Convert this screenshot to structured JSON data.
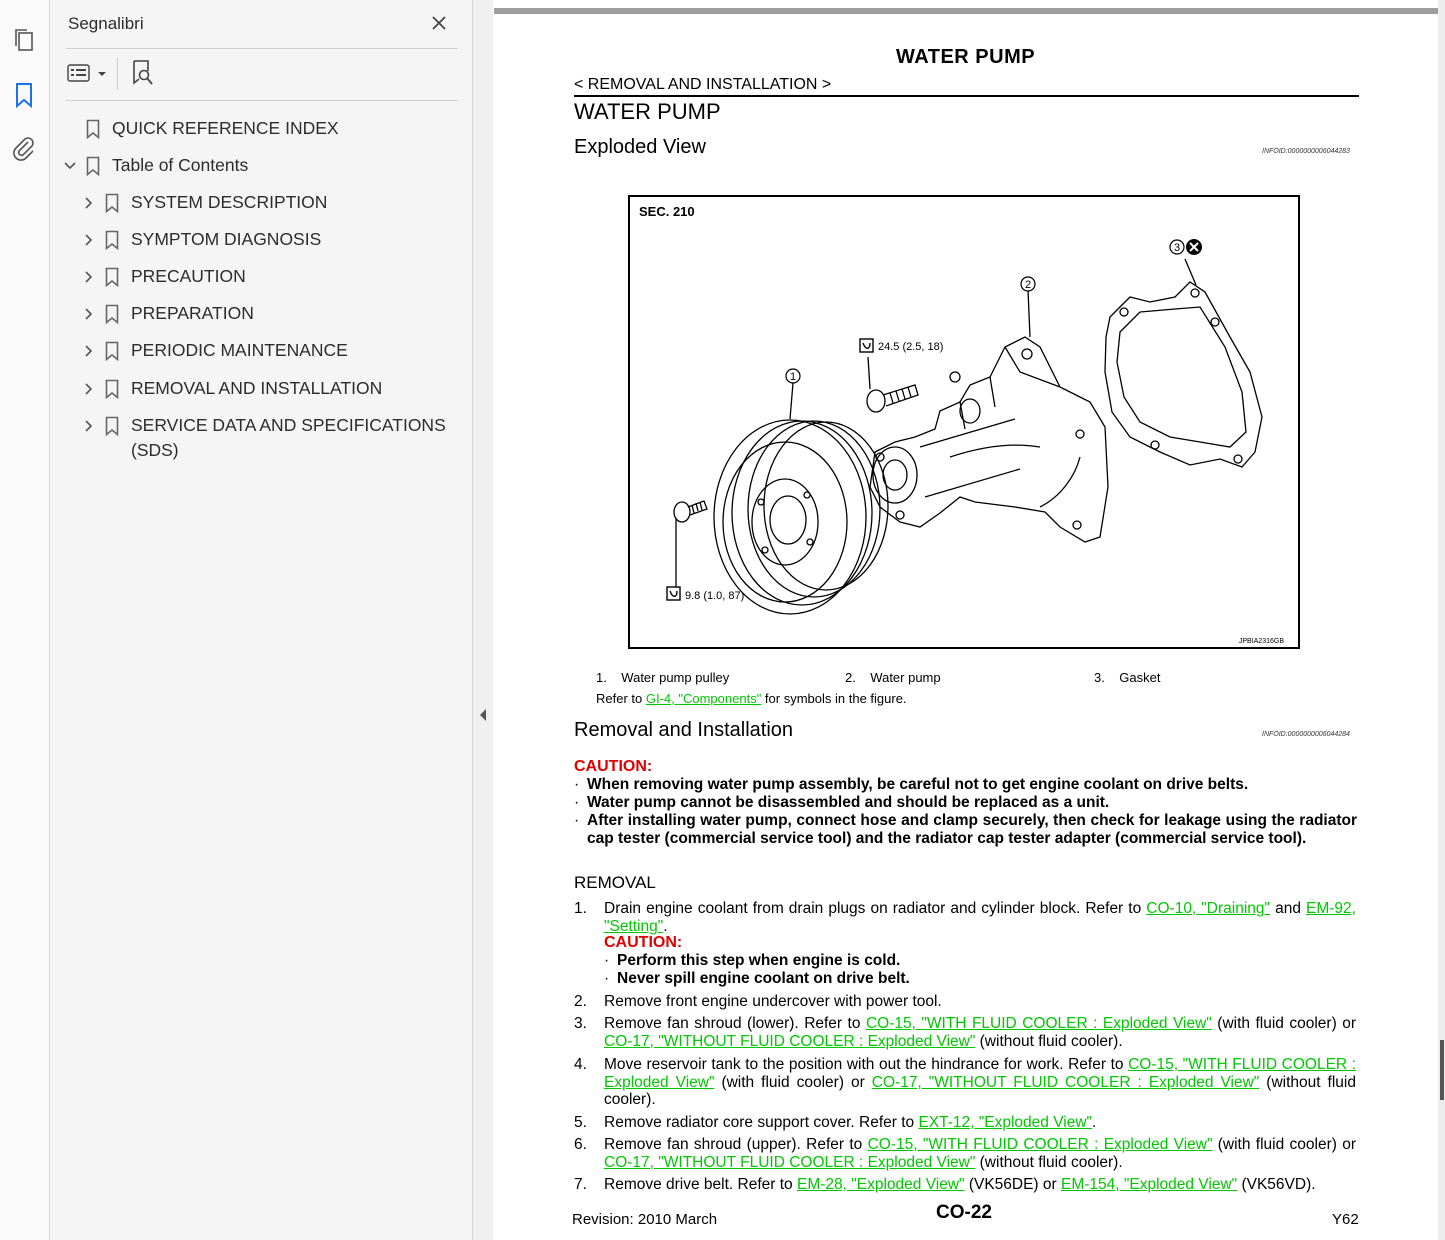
{
  "sidebar": {
    "title": "Segnalibri",
    "items": [
      {
        "label": "QUICK REFERENCE INDEX"
      },
      {
        "label": "Table of Contents"
      },
      {
        "label": "SYSTEM DESCRIPTION"
      },
      {
        "label": "SYMPTOM DIAGNOSIS"
      },
      {
        "label": "PRECAUTION"
      },
      {
        "label": "PREPARATION"
      },
      {
        "label": "PERIODIC MAINTENANCE"
      },
      {
        "label": "REMOVAL AND INSTALLATION"
      },
      {
        "label": "SERVICE DATA AND SPECIFICATIONS"
      },
      {
        "label": "(SDS)"
      }
    ]
  },
  "doc": {
    "header_title": "WATER PUMP",
    "header_sub": "< REMOVAL AND INSTALLATION >",
    "title": "WATER PUMP",
    "section1": "Exploded View",
    "infoid1": "INFOID:0000000006044283",
    "figure": {
      "sec": "SEC. 210",
      "torque1": "24.5 (2.5, 18)",
      "torque2": "9.8 (1.0, 87)",
      "callout1": "1",
      "callout2": "2",
      "callout3": "3",
      "code": "JPBIA2316GB"
    },
    "legend": [
      {
        "num": "1.",
        "text": "Water pump pulley"
      },
      {
        "num": "2.",
        "text": "Water pump"
      },
      {
        "num": "3.",
        "text": "Gasket"
      }
    ],
    "ref_pre": "Refer to ",
    "ref_link": "GI-4, \"Components\"",
    "ref_post": " for symbols in the figure.",
    "section2": "Removal and Installation",
    "infoid2": "INFOID:0000000006044284",
    "caution_label": "CAUTION:",
    "cautions": [
      "When removing water pump assembly, be careful not to get engine coolant on drive belts.",
      "Water pump cannot be disassembled and should be replaced as a unit.",
      "After installing water pump, connect hose and clamp securely, then check for leakage using the radiator cap tester (commercial service tool) and the radiator cap tester adapter (commercial service tool)."
    ],
    "removal_heading": "REMOVAL",
    "step1": {
      "num": "1.",
      "pre": "Drain engine coolant from drain plugs on radiator and cylinder block. Refer to ",
      "link1": "CO-10, \"Draining\"",
      "mid": " and ",
      "link2": "EM-92, \"Setting\"",
      "post": "."
    },
    "step1_caution_label": "CAUTION:",
    "step1_cautions": [
      "Perform this step when engine is cold.",
      "Never spill engine coolant on drive belt."
    ],
    "step2": {
      "num": "2.",
      "text": "Remove front engine undercover with power tool."
    },
    "step3": {
      "num": "3.",
      "pre": "Remove fan shroud (lower). Refer to ",
      "link1": "CO-15, \"WITH FLUID COOLER : Exploded View\"",
      "mid": " (with fluid cooler) or ",
      "link2": "CO-17, \"WITHOUT FLUID COOLER : Exploded View\"",
      "post": " (without fluid cooler)."
    },
    "step4": {
      "num": "4.",
      "pre": "Move reservoir tank to the position with out the hindrance for work. Refer to ",
      "link1": "CO-15, \"WITH FLUID COOLER : Exploded View\"",
      "mid": " (with fluid cooler) or ",
      "link2": "CO-17, \"WITHOUT FLUID COOLER : Exploded View\"",
      "post": " (without fluid cooler)."
    },
    "step5": {
      "num": "5.",
      "pre": "Remove radiator core support cover. Refer to ",
      "link1": "EXT-12, \"Exploded View\"",
      "post": "."
    },
    "step6": {
      "num": "6.",
      "pre": "Remove fan shroud (upper). Refer to ",
      "link1": "CO-15, \"WITH FLUID COOLER : Exploded View\"",
      "mid": " (with fluid cooler) or ",
      "link2": "CO-17, \"WITHOUT FLUID COOLER : Exploded View\"",
      "post": " (without fluid cooler)."
    },
    "step7": {
      "num": "7.",
      "pre": "Remove drive belt. Refer to ",
      "link1": "EM-28, \"Exploded View\"",
      "mid": " (VK56DE) or ",
      "link2": "EM-154, \"Exploded View\"",
      "post": " (VK56VD)."
    },
    "footer_left": "Revision: 2010 March",
    "footer_center": "CO-22",
    "footer_right": "Y62"
  },
  "colors": {
    "link": "#00c800",
    "caution": "#e00000",
    "accent": "#1a73e8"
  },
  "icons": [
    "pages-icon",
    "bookmark-icon",
    "attachment-icon",
    "close-icon",
    "list-options-icon",
    "find-bookmark-icon",
    "bookmark-ribbon-icon",
    "chevron-right-icon",
    "chevron-down-icon"
  ]
}
